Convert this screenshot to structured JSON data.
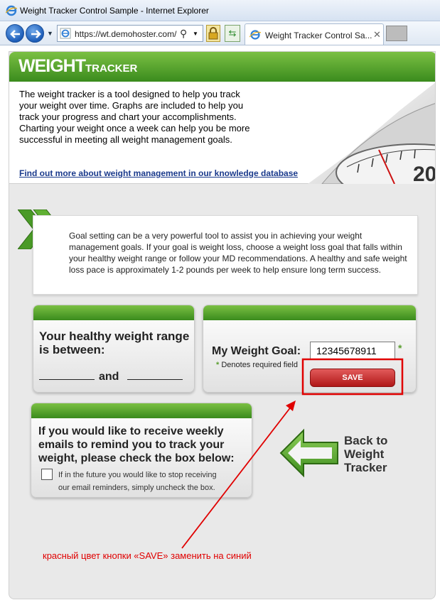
{
  "window": {
    "title": "Weight Tracker Control Sample - Internet Explorer"
  },
  "navbar": {
    "url": "https://wt.demohoster.com/",
    "tab_label": "Weight Tracker Control Sa...",
    "tab_close": "✕"
  },
  "header": {
    "logo_main": "WEIGHT",
    "logo_sub": "TRACKER"
  },
  "intro": {
    "text": "The weight tracker is a tool designed to help you track your weight over time. Graphs are included to help you track your progress and chart your accomplishments. Charting your weight once a week can help you be more successful in meeting all weight management goals.",
    "link": "Find out more about weight management in our knowledge database"
  },
  "goal_panel": {
    "text": "Goal setting can be a very powerful tool to assist you in achieving your weight management goals.  If your goal is weight loss, choose a weight loss goal that falls within your healthy weight range or follow your MD recommendations.  A healthy and safe weight loss pace is approximately 1-2 pounds per week to help ensure long term success."
  },
  "range_card": {
    "heading": "Your healthy weight range is between:",
    "and_label": "and"
  },
  "goal_card": {
    "label": "My Weight Goal:",
    "value": "12345678911",
    "required_star": "*",
    "required_note_star": "*",
    "required_note": " Denotes required field",
    "save_label": "SAVE"
  },
  "email_card": {
    "heading": "If you would like to receive weekly emails to remind you to track your weight, please check the box below:",
    "note": "If in the future you would like to stop receiving our email reminders, simply uncheck the box.",
    "checked": false
  },
  "back_link": {
    "label": "Back to Weight Tracker"
  },
  "annotation": {
    "text": "красный цвет кнопки «SAVE» заменить на синий",
    "color": "#e00000"
  },
  "colors": {
    "brand_green": "#3a8b1d",
    "save_red": "#b01818",
    "link_blue": "#1a3a8c"
  }
}
